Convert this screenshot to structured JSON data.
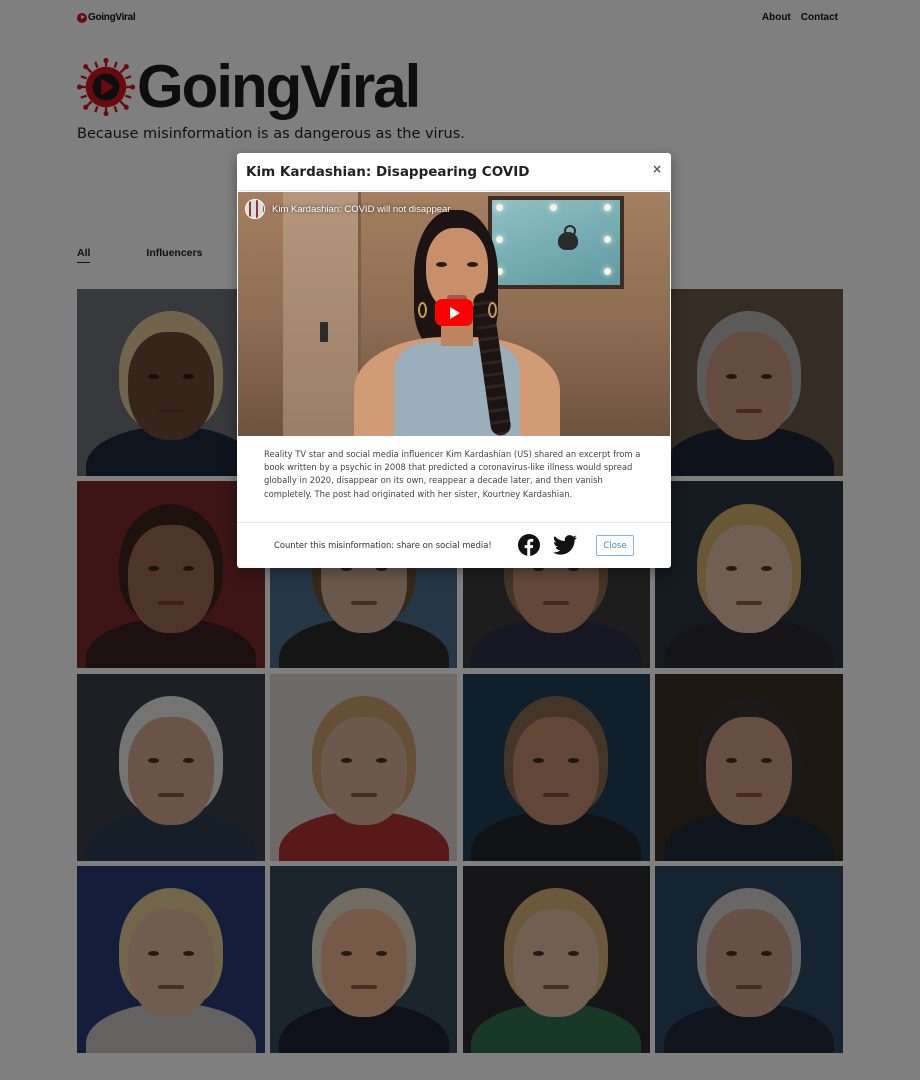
{
  "nav": {
    "logo_text": "GoingViral",
    "links": [
      "About",
      "Contact"
    ]
  },
  "hero": {
    "brand": "GoingViral",
    "tagline": "Because misinformation is as dangerous as the virus."
  },
  "filters": {
    "tabs": [
      "All",
      "Influencers"
    ],
    "active": "All"
  },
  "grid": {
    "cards": [
      {
        "bg": "#6f7378",
        "skin": "#6b4a35",
        "hair": "#e3c99a",
        "shirt": "#1e2a3f"
      },
      {
        "bg": "#9b8c7a",
        "skin": "#c9a084",
        "hair": "#3a2a20",
        "shirt": "#2a2a30"
      },
      {
        "bg": "#5a5c58",
        "skin": "#c48f70",
        "hair": "#5a4636",
        "shirt": "#2c3342"
      },
      {
        "bg": "#6a5a48",
        "skin": "#c9987c",
        "hair": "#b8b5b0",
        "shirt": "#1d2738"
      },
      {
        "bg": "#7a2a2a",
        "skin": "#9b6a4e",
        "hair": "#3b251a",
        "shirt": "#3a2020"
      },
      {
        "bg": "#4a6d8c",
        "skin": "#d6b09a",
        "hair": "#6a5034",
        "shirt": "#2a2a2a"
      },
      {
        "bg": "#3c3a3a",
        "skin": "#c49170",
        "hair": "#8a6a48",
        "shirt": "#2c2c4a"
      },
      {
        "bg": "#2b3540",
        "skin": "#e0c1a8",
        "hair": "#d5ae6a",
        "shirt": "#2a2832"
      },
      {
        "bg": "#3a3e4a",
        "skin": "#d3a88e",
        "hair": "#e9e9e6",
        "shirt": "#2d3c52"
      },
      {
        "bg": "#d8d2cc",
        "skin": "#d8b39a",
        "hair": "#caa06a",
        "shirt": "#b0332f"
      },
      {
        "bg": "#1e3f58",
        "skin": "#c38f70",
        "hair": "#8a6850",
        "shirt": "#23252d"
      },
      {
        "bg": "#3a2f25",
        "skin": "#cd9d80",
        "hair": "#3a3230",
        "shirt": "#1f2a3a"
      },
      {
        "bg": "#283a72",
        "skin": "#e2b9a0",
        "hair": "#e2cc95",
        "shirt": "#c8c4c2"
      },
      {
        "bg": "#344a5a",
        "skin": "#e8b48e",
        "hair": "#e3d9c4",
        "shirt": "#1d2332"
      },
      {
        "bg": "#2a2a30",
        "skin": "#e2bfa4",
        "hair": "#d8b277",
        "shirt": "#2f6e4e"
      },
      {
        "bg": "#2c4660",
        "skin": "#cfa08a",
        "hair": "#d2cfcc",
        "shirt": "#20283a"
      }
    ]
  },
  "modal": {
    "title": "Kim Kardashian: Disappearing COVID",
    "close_symbol": "×",
    "video_title": "Kim Kardashian: COVID will not disappear",
    "description": "Reality TV star and social media influencer Kim Kardashian (US) shared an excerpt from a book written by a psychic in 2008 that predicted a coronavirus-like illness would spread globally in 2020, disappear on its own, reappear a decade later, and then vanish completely. The post had originated with her sister, Kourtney Kardashian.",
    "share_text": "Counter this misinformation: share on social media!",
    "close_label": "Close",
    "icons": [
      "facebook-icon",
      "twitter-icon",
      "youtube-play-icon"
    ],
    "accent_color": "#d0151c",
    "youtube_color": "#ff0000",
    "button_color": "#3d8fc9"
  }
}
